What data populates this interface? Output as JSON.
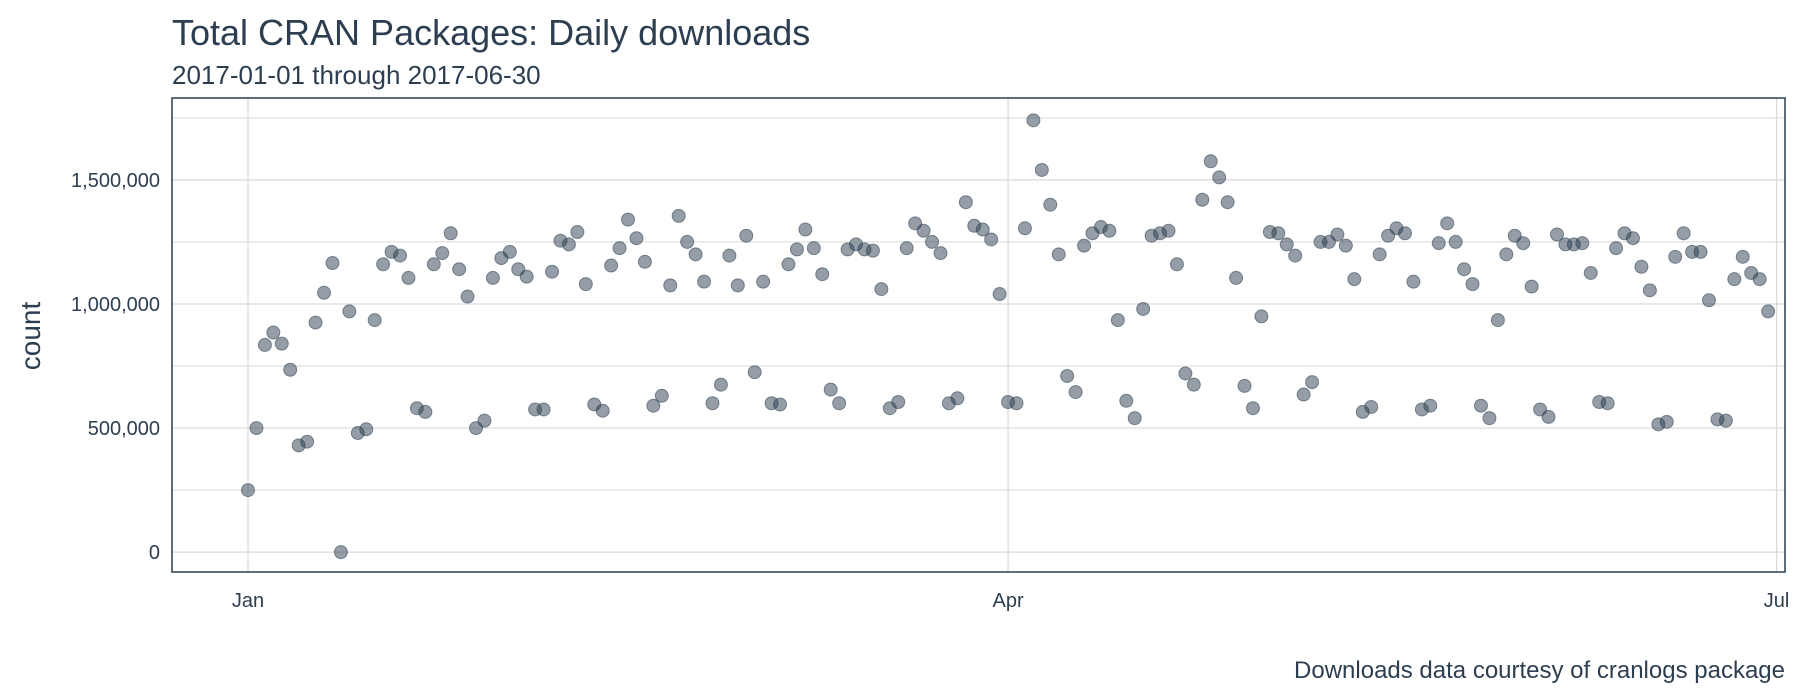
{
  "header": {
    "title": "Total CRAN Packages: Daily downloads",
    "subtitle": "2017-01-01 through 2017-06-30"
  },
  "caption": "Downloads data courtesy of cranlogs package",
  "colors": {
    "point": "#2c3e50",
    "border": "#2c3e50",
    "grid": "#d9d9d9",
    "text": "#2c3e50"
  },
  "chart_data": {
    "type": "scatter",
    "title": "Total CRAN Packages: Daily downloads",
    "subtitle": "2017-01-01 through 2017-06-30",
    "xlabel": "",
    "ylabel": "count",
    "x_tick_labels": [
      "Jan",
      "Apr",
      "Jul"
    ],
    "x_tick_values": [
      "2017-01-01",
      "2017-04-01",
      "2017-07-01"
    ],
    "y_tick_labels": [
      "0",
      "500,000",
      "1,000,000",
      "1,500,000"
    ],
    "y_tick_values": [
      0,
      500000,
      1000000,
      1500000
    ],
    "xlim": [
      "2016-12-23",
      "2017-07-02"
    ],
    "ylim": [
      -80000,
      1830000
    ],
    "grid": true,
    "caption": "Downloads data courtesy of cranlogs package",
    "series": [
      {
        "x": [
          "2017-01-01",
          "2017-01-02",
          "2017-01-03",
          "2017-01-04",
          "2017-01-05",
          "2017-01-06",
          "2017-01-07",
          "2017-01-08",
          "2017-01-09",
          "2017-01-10",
          "2017-01-11",
          "2017-01-12",
          "2017-01-13",
          "2017-01-14",
          "2017-01-15",
          "2017-01-16",
          "2017-01-17",
          "2017-01-18",
          "2017-01-19",
          "2017-01-20",
          "2017-01-21",
          "2017-01-22",
          "2017-01-23",
          "2017-01-24",
          "2017-01-25",
          "2017-01-26",
          "2017-01-27",
          "2017-01-28",
          "2017-01-29",
          "2017-01-30",
          "2017-01-31",
          "2017-02-01",
          "2017-02-02",
          "2017-02-03",
          "2017-02-04",
          "2017-02-05",
          "2017-02-06",
          "2017-02-07",
          "2017-02-08",
          "2017-02-09",
          "2017-02-10",
          "2017-02-11",
          "2017-02-12",
          "2017-02-13",
          "2017-02-14",
          "2017-02-15",
          "2017-02-16",
          "2017-02-17",
          "2017-02-18",
          "2017-02-19",
          "2017-02-20",
          "2017-02-21",
          "2017-02-22",
          "2017-02-23",
          "2017-02-24",
          "2017-02-25",
          "2017-02-26",
          "2017-02-27",
          "2017-02-28",
          "2017-03-01",
          "2017-03-02",
          "2017-03-03",
          "2017-03-04",
          "2017-03-05",
          "2017-03-06",
          "2017-03-07",
          "2017-03-08",
          "2017-03-09",
          "2017-03-10",
          "2017-03-11",
          "2017-03-12",
          "2017-03-13",
          "2017-03-14",
          "2017-03-15",
          "2017-03-16",
          "2017-03-17",
          "2017-03-18",
          "2017-03-19",
          "2017-03-20",
          "2017-03-21",
          "2017-03-22",
          "2017-03-23",
          "2017-03-24",
          "2017-03-25",
          "2017-03-26",
          "2017-03-27",
          "2017-03-28",
          "2017-03-29",
          "2017-03-30",
          "2017-03-31",
          "2017-04-01",
          "2017-04-02",
          "2017-04-03",
          "2017-04-04",
          "2017-04-05",
          "2017-04-06",
          "2017-04-07",
          "2017-04-08",
          "2017-04-09",
          "2017-04-10",
          "2017-04-11",
          "2017-04-12",
          "2017-04-13",
          "2017-04-14",
          "2017-04-15",
          "2017-04-16",
          "2017-04-17",
          "2017-04-18",
          "2017-04-19",
          "2017-04-20",
          "2017-04-21",
          "2017-04-22",
          "2017-04-23",
          "2017-04-24",
          "2017-04-25",
          "2017-04-26",
          "2017-04-27",
          "2017-04-28",
          "2017-04-29",
          "2017-04-30",
          "2017-05-01",
          "2017-05-02",
          "2017-05-03",
          "2017-05-04",
          "2017-05-05",
          "2017-05-06",
          "2017-05-07",
          "2017-05-08",
          "2017-05-09",
          "2017-05-10",
          "2017-05-11",
          "2017-05-12",
          "2017-05-13",
          "2017-05-14",
          "2017-05-15",
          "2017-05-16",
          "2017-05-17",
          "2017-05-18",
          "2017-05-19",
          "2017-05-20",
          "2017-05-21",
          "2017-05-22",
          "2017-05-23",
          "2017-05-24",
          "2017-05-25",
          "2017-05-26",
          "2017-05-27",
          "2017-05-28",
          "2017-05-29",
          "2017-05-30",
          "2017-05-31",
          "2017-06-01",
          "2017-06-02",
          "2017-06-03",
          "2017-06-04",
          "2017-06-05",
          "2017-06-06",
          "2017-06-07",
          "2017-06-08",
          "2017-06-09",
          "2017-06-10",
          "2017-06-11",
          "2017-06-12",
          "2017-06-13",
          "2017-06-14",
          "2017-06-15",
          "2017-06-16",
          "2017-06-17",
          "2017-06-18",
          "2017-06-19",
          "2017-06-20",
          "2017-06-21",
          "2017-06-22",
          "2017-06-23",
          "2017-06-24",
          "2017-06-25",
          "2017-06-26",
          "2017-06-27",
          "2017-06-28",
          "2017-06-29",
          "2017-06-30"
        ],
        "y": [
          250000,
          500000,
          835000,
          885000,
          840000,
          735000,
          430000,
          445000,
          925000,
          1045000,
          1165000,
          0,
          970000,
          480000,
          495000,
          935000,
          1160000,
          1210000,
          1195000,
          1105000,
          580000,
          565000,
          1160000,
          1205000,
          1285000,
          1140000,
          1030000,
          500000,
          530000,
          1105000,
          1185000,
          1210000,
          1140000,
          1110000,
          575000,
          575000,
          1130000,
          1255000,
          1240000,
          1290000,
          1080000,
          595000,
          570000,
          1155000,
          1225000,
          1340000,
          1265000,
          1170000,
          590000,
          630000,
          1075000,
          1355000,
          1250000,
          1200000,
          1090000,
          600000,
          675000,
          1195000,
          1075000,
          1275000,
          725000,
          1090000,
          600000,
          595000,
          1160000,
          1220000,
          1300000,
          1225000,
          1120000,
          655000,
          600000,
          1220000,
          1240000,
          1220000,
          1215000,
          1060000,
          580000,
          605000,
          1225000,
          1325000,
          1295000,
          1250000,
          1205000,
          600000,
          620000,
          1410000,
          1315000,
          1300000,
          1260000,
          1040000,
          605000,
          600000,
          1305000,
          1740000,
          1540000,
          1400000,
          1200000,
          710000,
          645000,
          1235000,
          1285000,
          1310000,
          1295000,
          935000,
          610000,
          540000,
          980000,
          1275000,
          1285000,
          1295000,
          1160000,
          720000,
          675000,
          1420000,
          1575000,
          1510000,
          1410000,
          1105000,
          670000,
          580000,
          950000,
          1290000,
          1285000,
          1240000,
          1195000,
          635000,
          685000,
          1250000,
          1250000,
          1280000,
          1235000,
          1100000,
          565000,
          585000,
          1200000,
          1275000,
          1305000,
          1285000,
          1090000,
          575000,
          590000,
          1245000,
          1325000,
          1250000,
          1140000,
          1080000,
          590000,
          540000,
          935000,
          1200000,
          1275000,
          1245000,
          1070000,
          575000,
          545000,
          1280000,
          1240000,
          1240000,
          1245000,
          1125000,
          605000,
          600000,
          1225000,
          1285000,
          1265000,
          1150000,
          1055000,
          515000,
          525000,
          1190000,
          1285000,
          1210000,
          1210000,
          1015000,
          535000,
          530000,
          1100000,
          1190000,
          1125000,
          1100000,
          970000
        ]
      }
    ]
  }
}
